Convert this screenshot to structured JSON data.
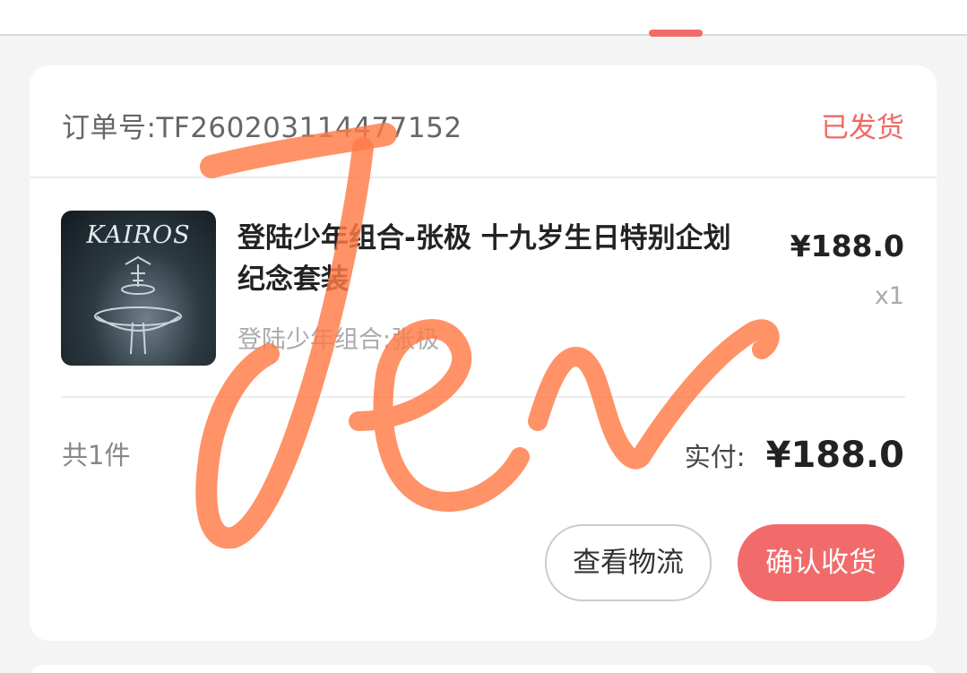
{
  "order": {
    "number_label": "订单号:TF260203114477152",
    "status": "已发货"
  },
  "product": {
    "thumb_brand": "KAIROS",
    "title": "登陆少年组合-张极 十九岁生日特别企划纪念套装",
    "subtitle": "登陆少年组合:张极",
    "price": "¥188.0",
    "quantity": "x1"
  },
  "summary": {
    "count": "共1件",
    "pay_label": "实付:",
    "pay_amount": "¥188.0"
  },
  "actions": {
    "logistics_label": "查看物流",
    "confirm_label": "确认收货"
  },
  "colors": {
    "accent": "#f26b6b",
    "status": "#ef6a63",
    "watermark": "#ff7a45"
  }
}
